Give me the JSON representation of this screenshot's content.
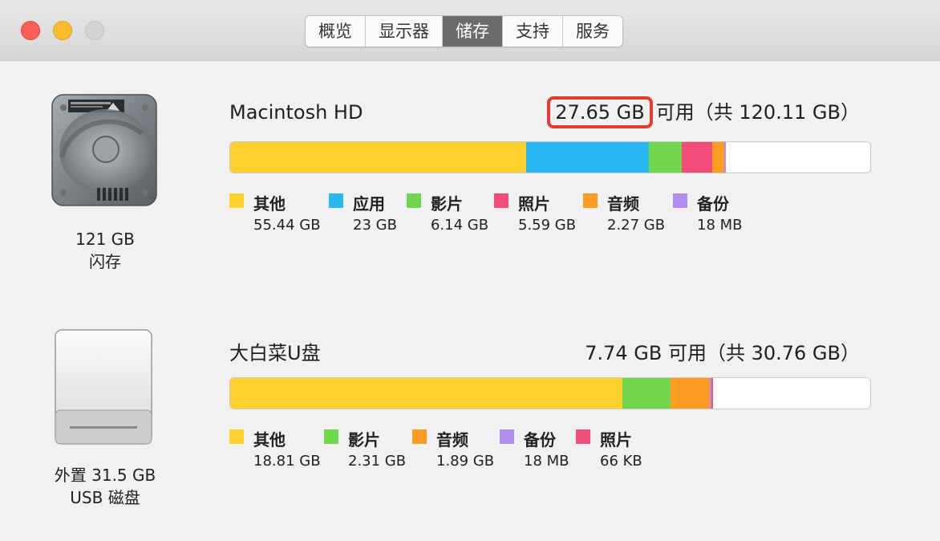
{
  "window": {
    "tabs": [
      {
        "label": "概览",
        "active": false
      },
      {
        "label": "显示器",
        "active": false
      },
      {
        "label": "储存",
        "active": true
      },
      {
        "label": "支持",
        "active": false
      },
      {
        "label": "服务",
        "active": false
      }
    ]
  },
  "colors": {
    "other": "#fed12d",
    "apps": "#2ab8f4",
    "movies": "#72d64c",
    "photos": "#f54d7a",
    "audio": "#fd9c24",
    "backups": "#b28df0",
    "highlight": "#e43b2c"
  },
  "drives": [
    {
      "icon": "internal-hard-drive-icon",
      "caption_line1": "121 GB",
      "caption_line2": "闪存",
      "name": "Macintosh HD",
      "free": "27.65 GB",
      "avail_suffix": "可用（共 120.11 GB）",
      "usage_fraction": {
        "other": 0.4616,
        "apps": 0.1915,
        "movies": 0.0511,
        "photos": 0.0465,
        "audio": 0.0189,
        "backups": 0.0002
      },
      "legend": [
        {
          "key": "other",
          "label": "其他",
          "size": "55.44 GB"
        },
        {
          "key": "apps",
          "label": "应用",
          "size": "23 GB"
        },
        {
          "key": "movies",
          "label": "影片",
          "size": "6.14 GB"
        },
        {
          "key": "photos",
          "label": "照片",
          "size": "5.59 GB"
        },
        {
          "key": "audio",
          "label": "音频",
          "size": "2.27 GB"
        },
        {
          "key": "backups",
          "label": "备份",
          "size": "18 MB"
        }
      ]
    },
    {
      "icon": "external-usb-drive-icon",
      "caption_line1": "外置 31.5 GB",
      "caption_line2": "USB 磁盘",
      "name": "大白菜U盘",
      "free": "7.74 GB",
      "avail_suffix": "可用（共 30.76 GB）",
      "usage_fraction": {
        "other": 0.6115,
        "movies": 0.0751,
        "audio": 0.0614,
        "backups": 0.0006,
        "photos": 1e-05
      },
      "legend": [
        {
          "key": "other",
          "label": "其他",
          "size": "18.81 GB"
        },
        {
          "key": "movies",
          "label": "影片",
          "size": "2.31 GB"
        },
        {
          "key": "audio",
          "label": "音频",
          "size": "1.89 GB"
        },
        {
          "key": "backups",
          "label": "备份",
          "size": "18 MB"
        },
        {
          "key": "photos",
          "label": "照片",
          "size": "66 KB"
        }
      ]
    }
  ]
}
